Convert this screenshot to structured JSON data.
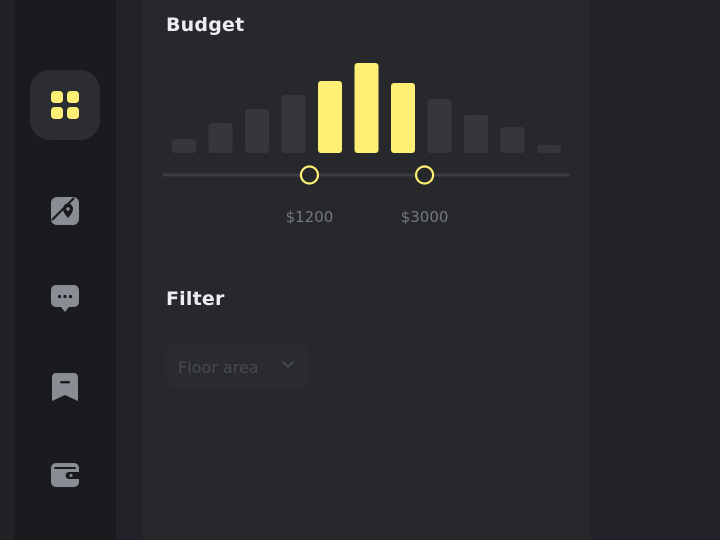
{
  "sidebar": {
    "items": [
      {
        "icon": "grid-icon",
        "active": true
      },
      {
        "icon": "map-pin-icon",
        "active": false
      },
      {
        "icon": "chat-bubble-icon",
        "active": false
      },
      {
        "icon": "bookmark-icon",
        "active": false
      },
      {
        "icon": "wallet-icon",
        "active": false
      }
    ]
  },
  "budget": {
    "title": "Budget",
    "range_low_label": "$1200",
    "range_high_label": "$3000",
    "histogram": [
      14,
      30,
      44,
      58,
      72,
      90,
      70,
      54,
      38,
      26,
      8
    ],
    "selected_bars": [
      4,
      5,
      6
    ],
    "selected_color": "#fcef74",
    "inactive_color": "#35373c",
    "handle_low_fraction": 0.36,
    "handle_high_fraction": 0.645
  },
  "filter": {
    "title": "Filter",
    "dropdown_value": "Floor area"
  }
}
